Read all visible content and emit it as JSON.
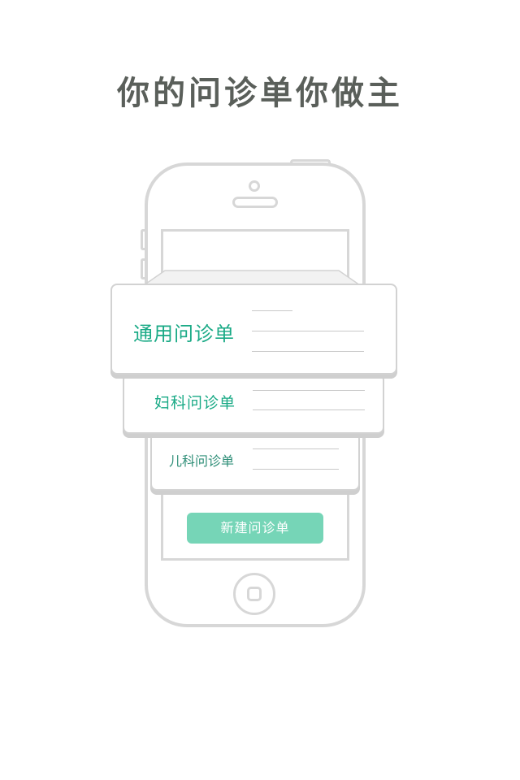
{
  "headline": "你的问诊单你做主",
  "cards": [
    {
      "label": "通用问诊单"
    },
    {
      "label": "妇科问诊单"
    },
    {
      "label": "儿科问诊单"
    }
  ],
  "new_button_label": "新建问诊单",
  "colors": {
    "accent_green": "#1aaa86",
    "button_green": "#76d5b7",
    "outline_gray": "#d7d7d7",
    "headline_gray": "#5a5f5a"
  },
  "icons": [
    "phone-outline-icon",
    "home-button-icon"
  ]
}
